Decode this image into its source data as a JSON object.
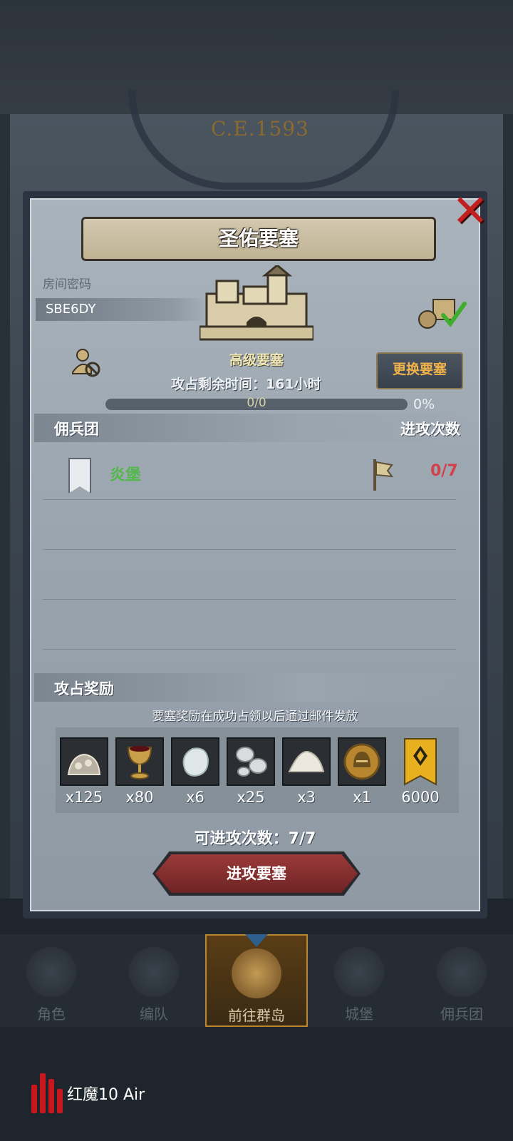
{
  "header": {
    "year": "C.E.1593"
  },
  "dialog": {
    "title": "圣佑要塞",
    "room_code_label": "房间密码",
    "room_code": "SBE6DY",
    "castle_name": "高级要塞",
    "swap_button": "更换要塞",
    "remaining_time": "攻占剩余时间：161小时",
    "progress": {
      "text": "0/0",
      "percent": "0%",
      "fraction": 0
    },
    "mercenary_header": "佣兵团",
    "attacks_header": "进攻次数",
    "mercenaries": [
      {
        "name": "炎堡",
        "attacks": "0/7"
      }
    ],
    "rewards_header": "攻占奖励",
    "rewards_note": "要塞奖励在成功占领以后通过邮件发放",
    "rewards": [
      {
        "icon": "ore-pile-icon",
        "qty": "x125"
      },
      {
        "icon": "goblet-icon",
        "qty": "x80"
      },
      {
        "icon": "white-gem-icon",
        "qty": "x6"
      },
      {
        "icon": "silver-coins-icon",
        "qty": "x25"
      },
      {
        "icon": "salt-pile-icon",
        "qty": "x3"
      },
      {
        "icon": "helmet-medal-icon",
        "qty": "x1"
      },
      {
        "icon": "rank-banner-icon",
        "qty": "6000"
      }
    ],
    "available_attacks": "可进攻次数：7/7",
    "attack_button": "进攻要塞"
  },
  "nav": {
    "items": [
      {
        "label": "角色",
        "active": false
      },
      {
        "label": "编队",
        "active": false
      },
      {
        "label": "前往群岛",
        "active": true
      },
      {
        "label": "城堡",
        "active": false
      },
      {
        "label": "佣兵团",
        "active": false
      }
    ]
  },
  "brand": {
    "text": "红魔10 Air"
  },
  "colors": {
    "merc_green": "#53b84a",
    "attack_red": "#d2424a",
    "swap_orange": "#f0b24a",
    "close_red": "#c41f1f"
  }
}
